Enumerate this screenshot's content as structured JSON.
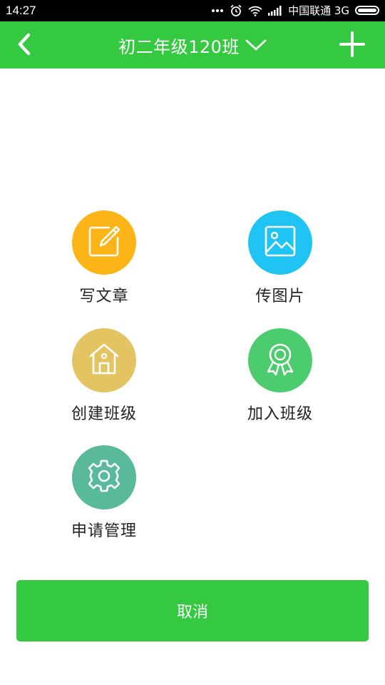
{
  "status_bar": {
    "time": "14:27",
    "carrier": "中国联通 3G",
    "icons": [
      "more-dots-icon",
      "alarm-icon",
      "wifi-icon",
      "signal-icon",
      "battery-icon"
    ]
  },
  "header": {
    "title": "初二年级120班",
    "back_icon": "chevron-left-icon",
    "dropdown_icon": "chevron-down-icon",
    "add_icon": "plus-icon"
  },
  "menu": {
    "items": [
      {
        "label": "写文章",
        "icon": "edit-icon",
        "color": "#fdb417"
      },
      {
        "label": "传图片",
        "icon": "image-icon",
        "color": "#1fc4f5"
      },
      {
        "label": "创建班级",
        "icon": "house-icon",
        "color": "#e4c462"
      },
      {
        "label": "加入班级",
        "icon": "award-icon",
        "color": "#4ccc6e"
      },
      {
        "label": "申请管理",
        "icon": "gear-icon",
        "color": "#58b99b"
      }
    ]
  },
  "cancel_button": {
    "label": "取消"
  },
  "colors": {
    "accent": "#34c940",
    "status_bar": "#000000"
  }
}
